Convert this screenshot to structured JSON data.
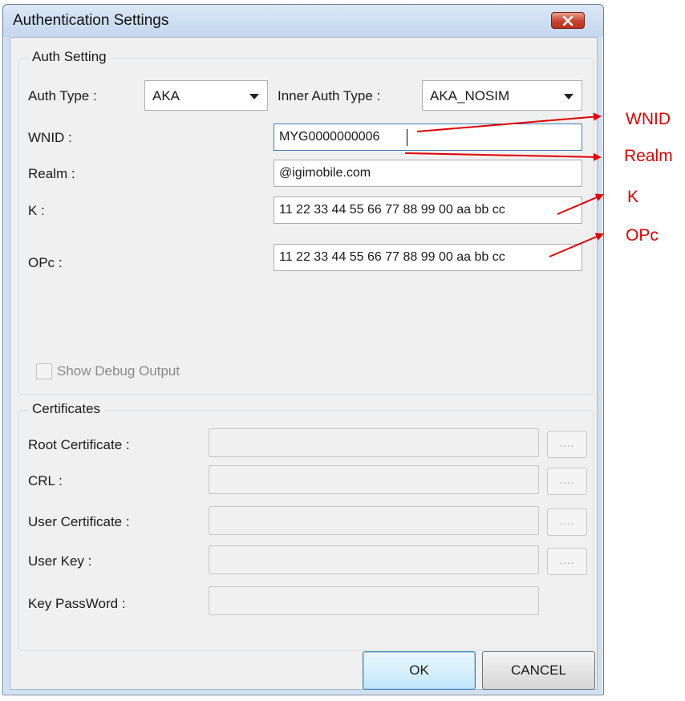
{
  "window": {
    "title": "Authentication Settings"
  },
  "auth_setting": {
    "group_label": "Auth Setting",
    "auth_type_label": "Auth Type :",
    "auth_type_value": "AKA",
    "inner_auth_type_label": "Inner Auth Type :",
    "inner_auth_type_value": "AKA_NOSIM",
    "wnid_label": "WNID :",
    "wnid_value": "MYG0000000006",
    "realm_label": "Realm :",
    "realm_value": "@igimobile.com",
    "k_label": "K :",
    "k_value": "11 22 33 44 55 66 77 88 99 00 aa bb cc",
    "opc_label": "OPc :",
    "opc_value": "11 22 33 44 55 66 77 88 99 00 aa bb cc",
    "show_debug_label": "Show Debug Output",
    "show_debug_checked": false
  },
  "certificates": {
    "group_label": "Certificates",
    "root_cert_label": "Root Certificate :",
    "crl_label": "CRL :",
    "user_cert_label": "User Certificate :",
    "user_key_label": "User Key :",
    "key_password_label": "Key PassWord :",
    "browse_label": "...."
  },
  "buttons": {
    "ok": "OK",
    "cancel": "CANCEL"
  },
  "annotations": {
    "wnid": "WNID",
    "realm": "Realm",
    "k": "K",
    "opc": "OPc",
    "color": "#e00000"
  }
}
